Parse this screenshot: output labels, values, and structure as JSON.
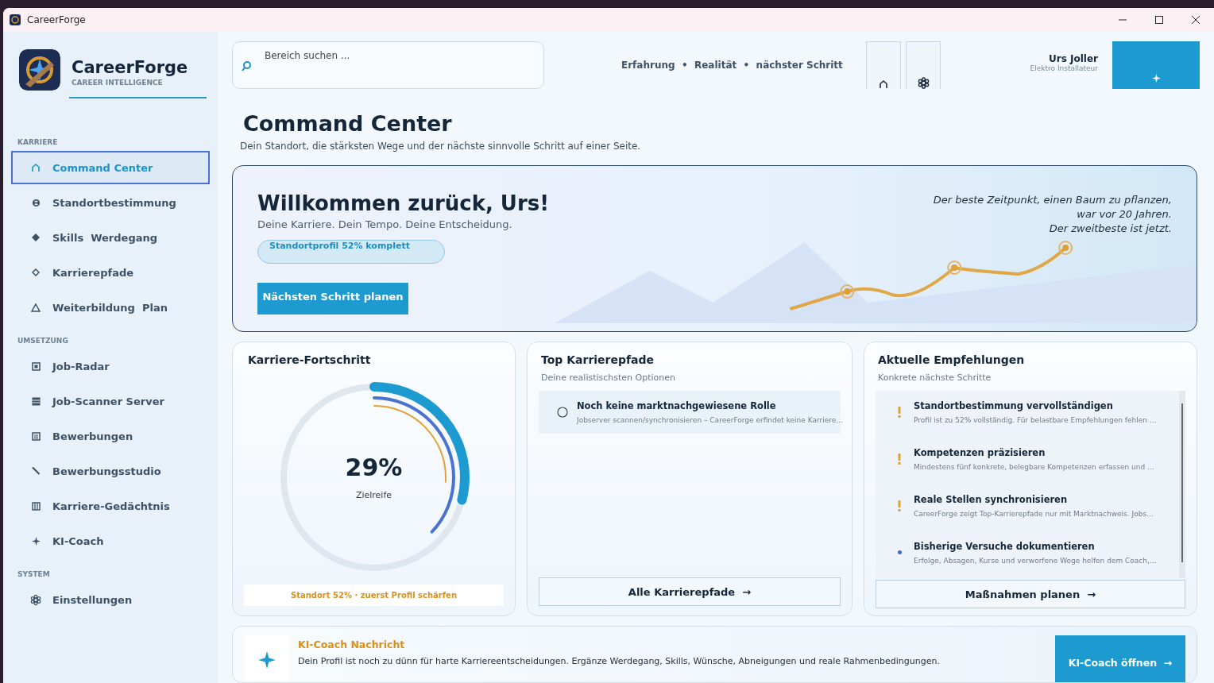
{
  "window": {
    "title": "CareerForge"
  },
  "brand": {
    "name": "CareerForge",
    "tagline": "CAREER INTELLIGENCE"
  },
  "sidebar": {
    "sections": [
      {
        "heading": "KARRIERE",
        "items": [
          {
            "label": "Command Center",
            "kind": "home",
            "selected": true
          },
          {
            "label": "Standortbestimmung",
            "kind": "target",
            "selected": false
          },
          {
            "label": "Skills  Werdegang",
            "kind": "diamond",
            "selected": false
          },
          {
            "label": "Karrierepfade",
            "kind": "diamond-outline",
            "selected": false
          },
          {
            "label": "Weiterbildung  Plan",
            "kind": "triangle",
            "selected": false
          }
        ]
      },
      {
        "heading": "UMSETZUNG",
        "items": [
          {
            "label": "Job-Radar",
            "kind": "square",
            "selected": false
          },
          {
            "label": "Job-Scanner Server",
            "kind": "server",
            "selected": false
          },
          {
            "label": "Bewerbungen",
            "kind": "list",
            "selected": false
          },
          {
            "label": "Bewerbungsstudio",
            "kind": "pen",
            "selected": false
          },
          {
            "label": "Karriere-Gedächtnis",
            "kind": "columns",
            "selected": false
          },
          {
            "label": "KI-Coach",
            "kind": "sparkle",
            "selected": false
          }
        ]
      },
      {
        "heading": "SYSTEM",
        "items": [
          {
            "label": "Einstellungen",
            "kind": "gear",
            "selected": false
          }
        ]
      }
    ]
  },
  "search": {
    "placeholder": "Bereich suchen ..."
  },
  "motto": "Erfahrung  •  Realität  •  nächster Schritt",
  "user": {
    "name": "Urs Joller",
    "role": "Elektro Installateur"
  },
  "page": {
    "title": "Command Center",
    "subtitle": "Dein Standort, die stärksten Wege und der nächste sinnvolle Schritt auf einer Seite."
  },
  "hero": {
    "title": "Willkommen zurück, Urs!",
    "subtitle": "Deine Karriere. Dein Tempo. Deine Entscheidung.",
    "badge": "Standortprofil 52% komplett",
    "button": "Nächsten Schritt planen",
    "quote": [
      "Der beste Zeitpunkt, einen Baum zu pflanzen,",
      "war vor 20 Jahren.",
      "Der zweitbeste ist jetzt."
    ]
  },
  "progress": {
    "title": "Karriere-Fortschritt",
    "value": "29%",
    "label": "Zielreife",
    "level": 0.29,
    "footer": "Standort 52% · zuerst Profil schärfen"
  },
  "paths": {
    "title": "Top Karrierepfade",
    "subtitle": "Deine realistischsten Optionen",
    "items": [
      {
        "title": "Noch keine marktnachgewiesene Rolle",
        "detail": "Jobserver scannen/synchronisieren – CareerForge erfindet keine Karriere..."
      }
    ],
    "button": "Alle Karrierepfade  →"
  },
  "recommendations": {
    "title": "Aktuelle Empfehlungen",
    "subtitle": "Konkrete nächste Schritte",
    "items": [
      {
        "kind": "warning",
        "title": "Standortbestimmung vervollständigen",
        "detail": "Profil ist zu 52% vollständig. Für belastbare Empfehlungen fehlen ..."
      },
      {
        "kind": "warning",
        "title": "Kompetenzen präzisieren",
        "detail": "Mindestens fünf konkrete, belegbare Kompetenzen erfassen und ..."
      },
      {
        "kind": "warning",
        "title": "Reale Stellen synchronisieren",
        "detail": "CareerForge zeigt Top-Karrierepfade nur mit Marktnachweis. Jobs..."
      },
      {
        "kind": "info",
        "title": "Bisherige Versuche dokumentieren",
        "detail": "Erfolge, Absagen, Kurse und verworfene Wege helfen dem Coach,..."
      }
    ],
    "button": "Maßnahmen planen  →"
  },
  "coach": {
    "title": "KI-Coach Nachricht",
    "message": "Dein Profil ist noch zu dünn für harte Karriereentscheidungen. Ergänze Werdegang, Skills, Wünsche, Abneigungen und reale Rahmenbedingungen.",
    "button": "KI-Coach öffnen  →"
  }
}
